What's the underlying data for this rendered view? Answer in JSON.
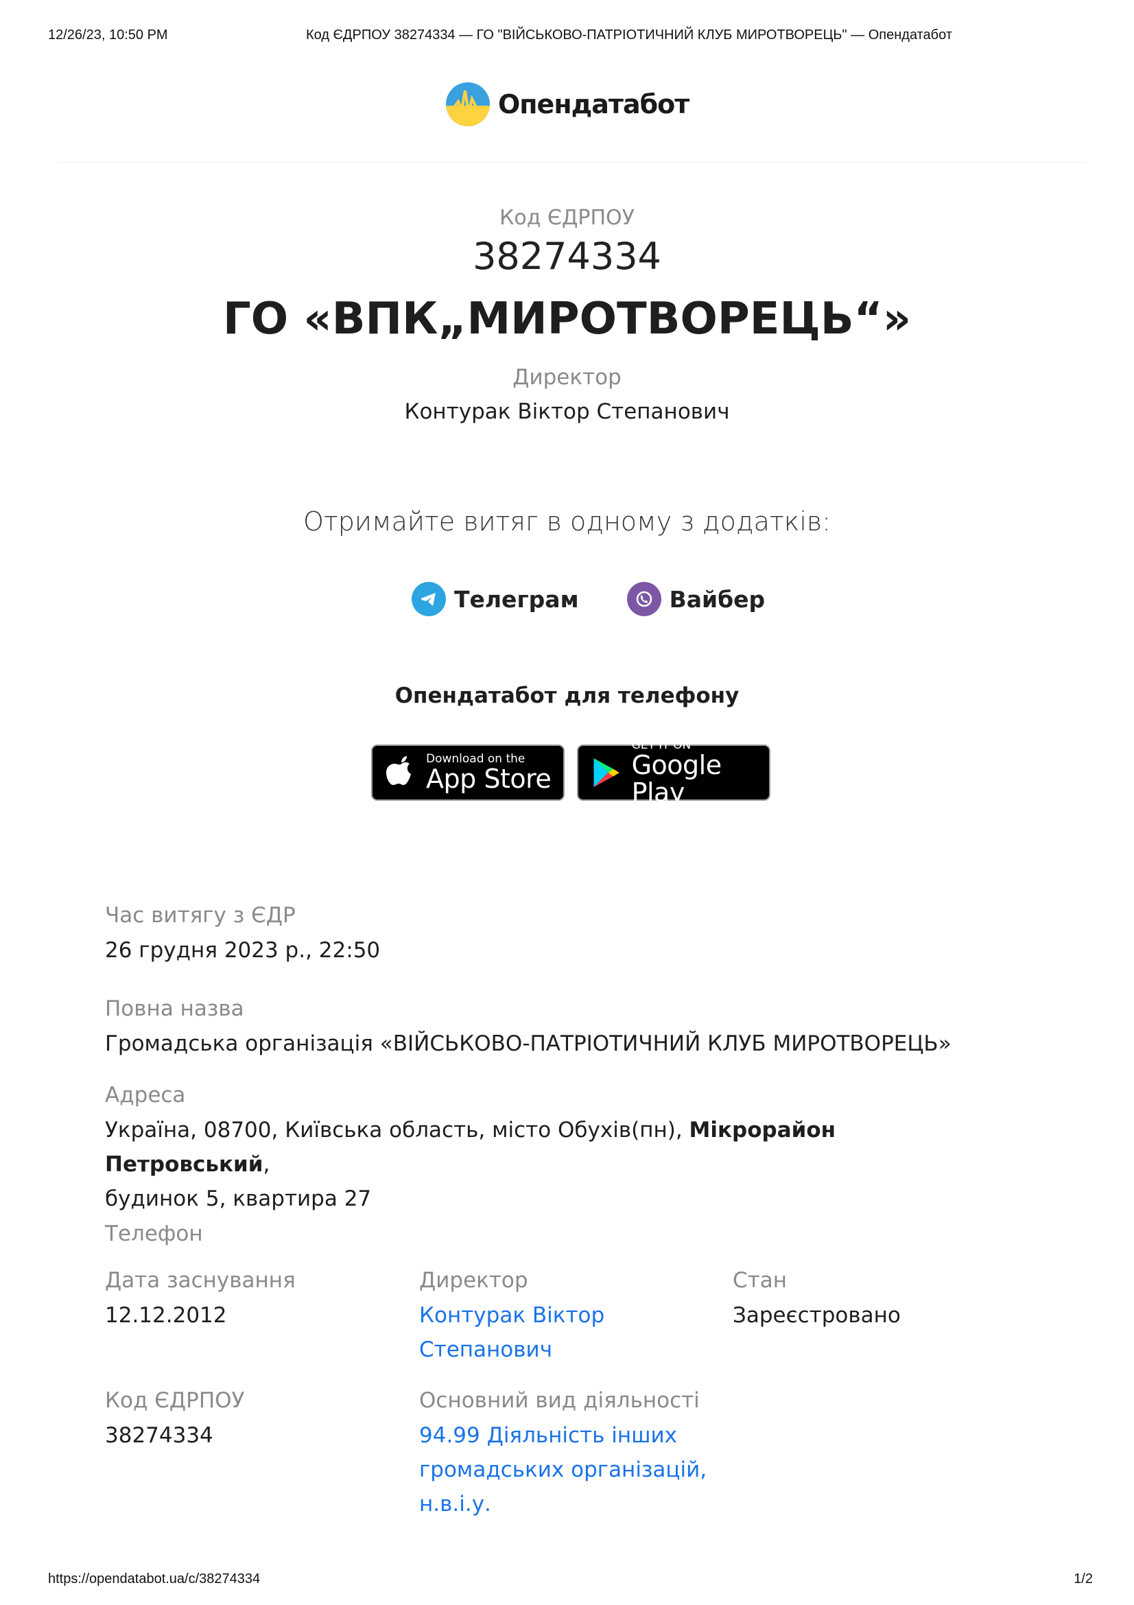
{
  "print_header": {
    "date": "12/26/23, 10:50 PM",
    "title": "Код ЄДРПОУ 38274334 — ГО \"ВІЙСЬКОВО-ПАТРІОТИЧНИЙ КЛУБ МИРОТВОРЕЦЬ\" — Опендатабот"
  },
  "print_footer": {
    "url": "https://opendatabot.ua/c/38274334",
    "page": "1/2"
  },
  "logo": {
    "text": "Опендатабот",
    "icon": "opendatabot-logo-icon"
  },
  "header": {
    "edrpou_label": "Код ЄДРПОУ",
    "edrpou_code": "38274334",
    "org_short_name": "ГО «ВПК„МИРОТВОРЕЦЬ“»",
    "director_label": "Директор",
    "director_name": "Контурак Віктор Степанович"
  },
  "cta": {
    "text": "Отримайте витяг в одному з додатків:",
    "telegram_label": "Телеграм",
    "viber_label": "Вайбер",
    "telegram_icon": "telegram-icon",
    "viber_icon": "viber-icon"
  },
  "phone_apps": {
    "title": "Опендатабот для телефону",
    "appstore_small": "Download on the",
    "appstore_big": "App Store",
    "googleplay_small": "GET IT ON",
    "googleplay_big": "Google Play"
  },
  "details": {
    "extract_time_label": "Час витягу з ЄДР",
    "extract_time_value": "26 грудня 2023 р., 22:50",
    "full_name_label": "Повна назва",
    "full_name_value": "Громадська організація «ВІЙСЬКОВО-ПАТРІОТИЧНИЙ КЛУБ МИРОТВОРЕЦЬ»",
    "address_label": "Адреса",
    "address_part1": "Україна, 08700, Київська область, місто Обухів(пн), ",
    "address_bold": "Мікрорайон Петровський",
    "address_part2": ",",
    "address_line2": "будинок 5, квартира 27",
    "phone_label": "Телефон",
    "founded_label": "Дата заснування",
    "founded_value": "12.12.2012",
    "director_label": "Директор",
    "director_line1": "Контурак Віктор",
    "director_line2": "Степанович",
    "status_label": "Стан",
    "status_value": "Зареєстровано",
    "edrpou_label": "Код ЄДРПОУ",
    "edrpou_value": "38274334",
    "activity_label": "Основний вид діяльності",
    "activity_line1": "94.99 Діяльність інших",
    "activity_line2": "громадських організацій,",
    "activity_line3": "н.в.і.у."
  }
}
